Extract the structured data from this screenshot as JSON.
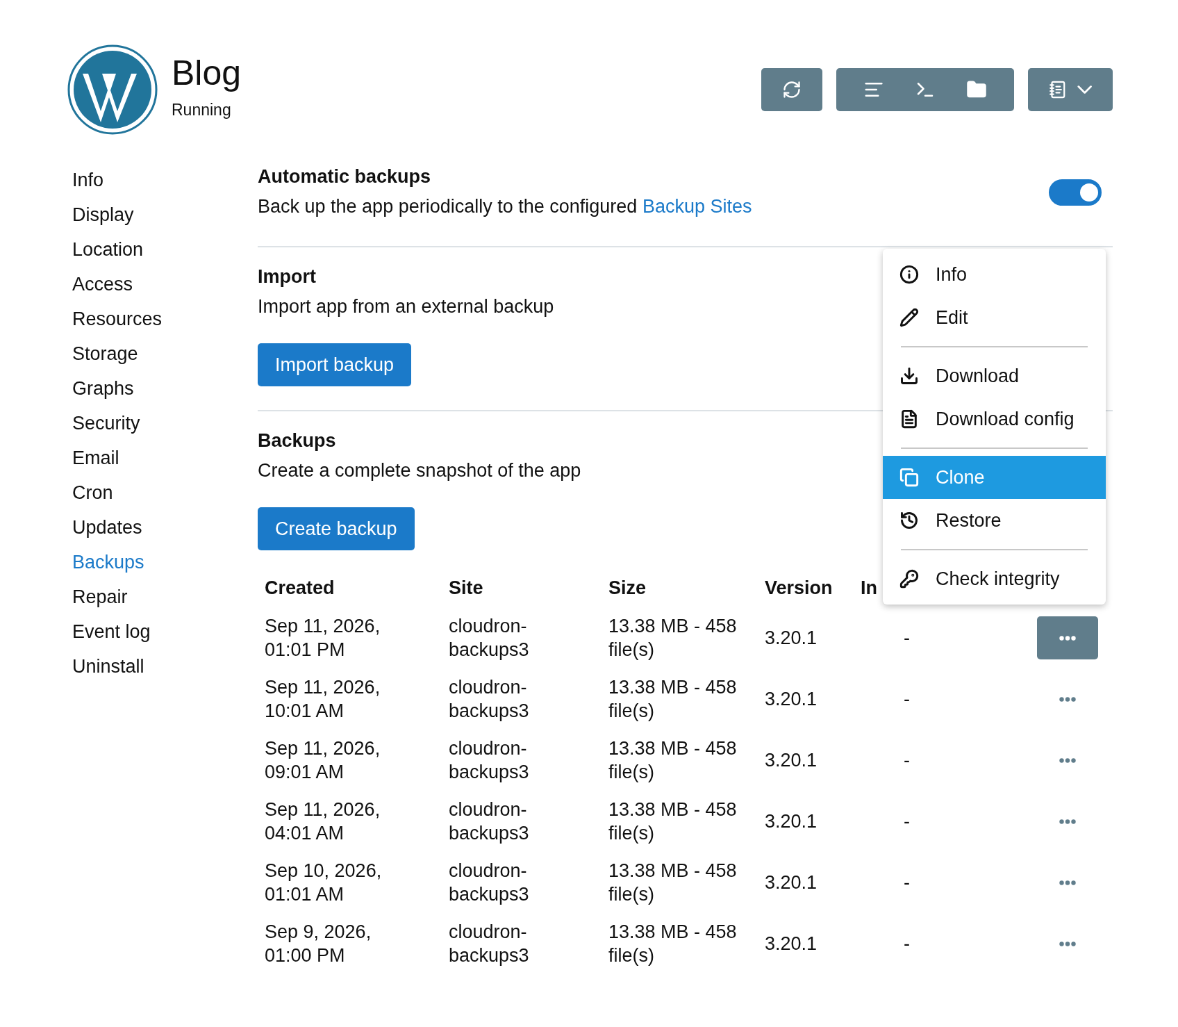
{
  "app": {
    "title": "Blog",
    "status": "Running"
  },
  "sidebar": {
    "items": [
      {
        "label": "Info",
        "selected": false
      },
      {
        "label": "Display",
        "selected": false
      },
      {
        "label": "Location",
        "selected": false
      },
      {
        "label": "Access",
        "selected": false
      },
      {
        "label": "Resources",
        "selected": false
      },
      {
        "label": "Storage",
        "selected": false
      },
      {
        "label": "Graphs",
        "selected": false
      },
      {
        "label": "Security",
        "selected": false
      },
      {
        "label": "Email",
        "selected": false
      },
      {
        "label": "Cron",
        "selected": false
      },
      {
        "label": "Updates",
        "selected": false
      },
      {
        "label": "Backups",
        "selected": true
      },
      {
        "label": "Repair",
        "selected": false
      },
      {
        "label": "Event log",
        "selected": false
      },
      {
        "label": "Uninstall",
        "selected": false
      }
    ]
  },
  "automatic_backups": {
    "title": "Automatic backups",
    "description": "Back up the app periodically to the configured",
    "link": "Backup Sites",
    "on": true
  },
  "import": {
    "title": "Import",
    "description": "Import app from an external backup",
    "button": "Import backup"
  },
  "backups": {
    "title": "Backups",
    "description": "Create a complete snapshot of the app",
    "button": "Create backup",
    "table": {
      "columns": [
        "Created",
        "Site",
        "Size",
        "Version",
        "In"
      ],
      "rows": [
        {
          "created": "Sep 11, 2026, 01:01 PM",
          "site": "cloudron-backups3",
          "size": "13.38 MB - 458 file(s)",
          "version": "3.20.1",
          "column_5": "-",
          "menu_open": true
        },
        {
          "created": "Sep 11, 2026, 10:01 AM",
          "site": "cloudron-backups3",
          "size": "13.38 MB - 458 file(s)",
          "version": "3.20.1",
          "column_5": "-",
          "menu_open": false
        },
        {
          "created": "Sep 11, 2026, 09:01 AM",
          "site": "cloudron-backups3",
          "size": "13.38 MB - 458 file(s)",
          "version": "3.20.1",
          "column_5": "-",
          "menu_open": false
        },
        {
          "created": "Sep 11, 2026, 04:01 AM",
          "site": "cloudron-backups3",
          "size": "13.38 MB - 458 file(s)",
          "version": "3.20.1",
          "column_5": "-",
          "menu_open": false
        },
        {
          "created": "Sep 10, 2026, 01:01 AM",
          "site": "cloudron-backups3",
          "size": "13.38 MB - 458 file(s)",
          "version": "3.20.1",
          "column_5": "-",
          "menu_open": false
        },
        {
          "created": "Sep 9, 2026, 01:00 PM",
          "site": "cloudron-backups3",
          "size": "13.38 MB - 458 file(s)",
          "version": "3.20.1",
          "column_5": "-",
          "menu_open": false
        }
      ]
    }
  },
  "context_menu": {
    "groups": [
      [
        {
          "label": "Info",
          "selected": false
        },
        {
          "label": "Edit",
          "selected": false
        }
      ],
      [
        {
          "label": "Download",
          "selected": false
        },
        {
          "label": "Download config",
          "selected": false
        }
      ],
      [
        {
          "label": "Clone",
          "selected": true
        },
        {
          "label": "Restore",
          "selected": false
        }
      ],
      [
        {
          "label": "Check integrity",
          "selected": false
        }
      ]
    ]
  }
}
